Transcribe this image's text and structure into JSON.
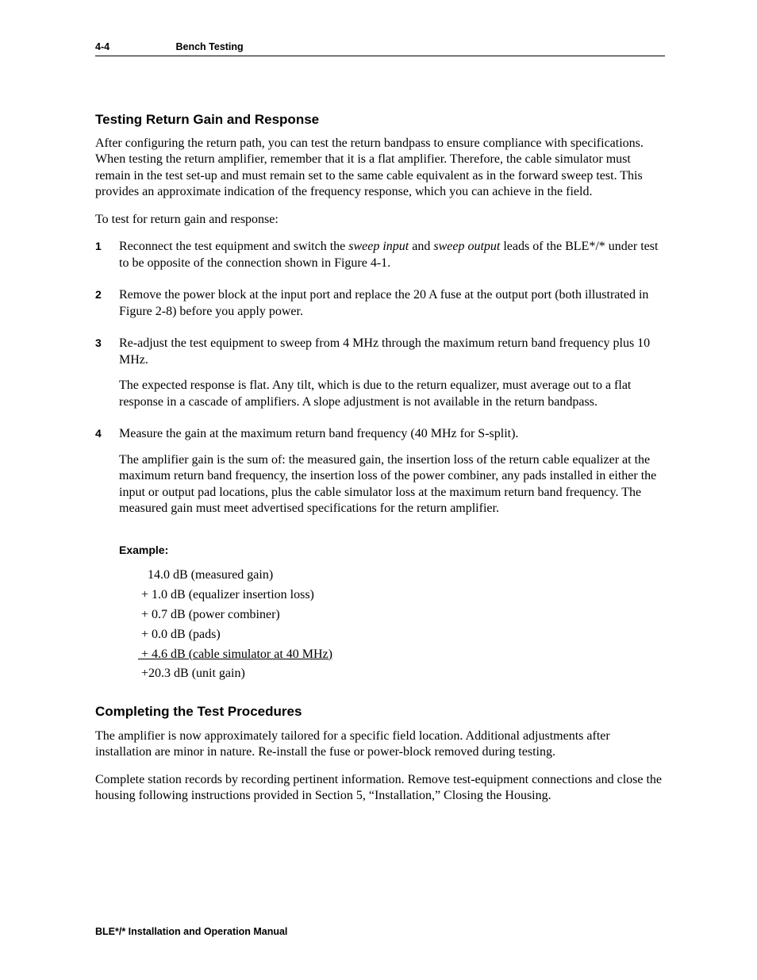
{
  "header": {
    "page_number": "4-4",
    "section": "Bench Testing"
  },
  "sec1": {
    "heading": "Testing Return Gain and Response",
    "p1": "After configuring the return path, you can test the return bandpass to ensure compliance with specifications. When testing the return amplifier, remember that it is a flat amplifier. Therefore, the cable simulator must remain in the test set-up and must remain set to the same cable equivalent as in the forward sweep test. This provides an approximate indication of the frequency response, which you can achieve in the field.",
    "p2": "To test for return gain and response:",
    "steps": {
      "s1": {
        "num": "1",
        "pre": "Reconnect the test equipment and switch the ",
        "term1": "sweep input",
        "mid": " and ",
        "term2": "sweep output",
        "post": " leads of the BLE*/* under test to be opposite of the connection shown in Figure 4-1."
      },
      "s2": {
        "num": "2",
        "text": "Remove the power block at the input port and replace the 20 A fuse at the output port (both illustrated in Figure 2-8) before you apply power."
      },
      "s3": {
        "num": "3",
        "p1": "Re-adjust the test equipment to sweep from 4 MHz through the maximum return band frequency plus 10 MHz.",
        "p2": "The expected response is flat. Any tilt, which is due to the return equalizer, must average out to a flat response in a cascade of amplifiers. A slope adjustment is not available in the return bandpass."
      },
      "s4": {
        "num": "4",
        "p1": "Measure the gain at the maximum return band frequency (40 MHz for S-split).",
        "p2": "The amplifier gain is the sum of: the measured gain, the insertion loss of the return cable equalizer at the maximum return band frequency, the insertion loss of the power combiner, any pads installed in either the input or output pad locations, plus the cable simulator loss at the maximum return band frequency. The measured gain must meet advertised specifications for the return amplifier."
      }
    },
    "example": {
      "label": "Example:",
      "lines": {
        "l1": "   14.0 dB (measured gain)",
        "l2": " + 1.0 dB (equalizer insertion loss)",
        "l3": " + 0.7 dB (power combiner)",
        "l4": " + 0.0 dB (pads)",
        "l5": " + 4.6 dB (cable simulator at 40 MHz)",
        "l6": " +20.3 dB (unit gain)"
      }
    }
  },
  "sec2": {
    "heading": "Completing the Test Procedures",
    "p1": "The amplifier is now approximately tailored for a specific field location. Additional adjustments after installation are minor in nature. Re-install the fuse or power-block removed during testing.",
    "p2": "Complete station records by recording pertinent information. Remove test-equipment connections and close the housing following instructions provided in Section 5, “Installation,” Closing the Housing."
  },
  "footer": {
    "text": "BLE*/* Installation and Operation Manual"
  }
}
